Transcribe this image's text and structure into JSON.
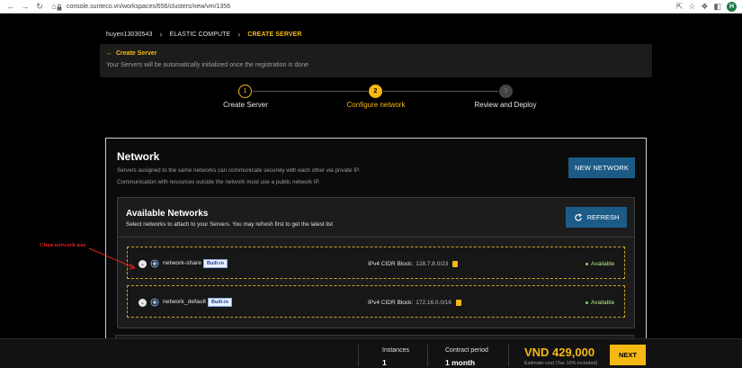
{
  "browser": {
    "url": "console.sunteco.vn/workspaces/656/clusters/new/vm/1356",
    "avatar_letter": "H"
  },
  "breadcrumb": {
    "items": [
      "huyen13030543",
      "ELASTIC COMPUTE",
      "CREATE SERVER"
    ]
  },
  "notice": {
    "back_label": "Create Server",
    "message": "Your Servers will be automatically initialized once the registration is done"
  },
  "stepper": {
    "steps": [
      {
        "number": "1",
        "label": "Create Server"
      },
      {
        "number": "2",
        "label": "Configure network"
      },
      {
        "number": "3",
        "label": "Review and Deploy"
      }
    ],
    "active_step": 2
  },
  "network": {
    "title": "Network",
    "desc1": "Servers assigned to the same networks can communicate securely with each other via private IP.",
    "desc2": "Communication with resources outside the network must use a public network IP.",
    "new_button": "NEW NETWORK"
  },
  "available": {
    "title": "Available Networks",
    "subtitle": "Select networks to attach to your Servers. You may refresh first to get the latest list",
    "refresh_button": "REFRESH",
    "rows": [
      {
        "name": "network-share",
        "badge": "Built-in",
        "cidr_label": "IPv4 CIDR Block:",
        "cidr": "128.7.8.0/23",
        "status": "Available"
      },
      {
        "name": "network_default",
        "badge": "Built-in",
        "cidr_label": "IPv4 CIDR Block:",
        "cidr": "172.16.0.0/16",
        "status": "Available"
      }
    ]
  },
  "annotation": {
    "text": "Chọn network này"
  },
  "footer": {
    "instances_label": "Instances",
    "instances_value": "1",
    "period_label": "Contract period",
    "period_value": "1 month",
    "price": "VND 429,000",
    "estimate": "Estimate cost (Tax 10% included)",
    "next_button": "NEXT"
  },
  "colors": {
    "accent": "#f6b913",
    "button_blue": "#1d5b87",
    "status_green": "#7ed957"
  }
}
